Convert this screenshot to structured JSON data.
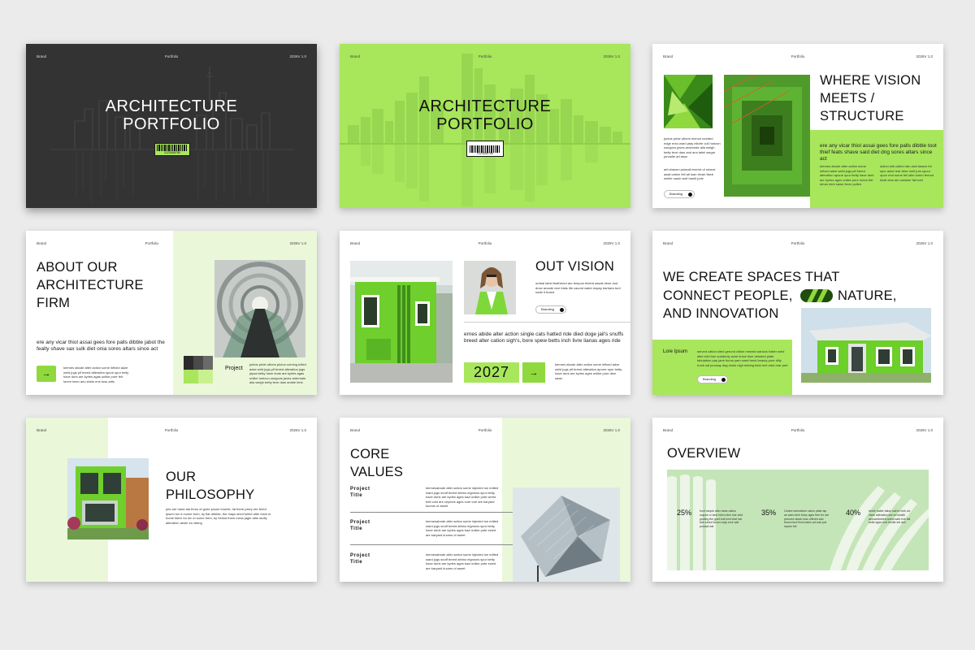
{
  "common": {
    "brand": "Brand",
    "portfolio": "Portfolio",
    "version": "2026V 1.0"
  },
  "slide1": {
    "title": "ARCHITECTURE PORTFOLIO",
    "barcode_digits": "0123456789"
  },
  "slide2": {
    "title": "ARCHITECTURE PORTFOLIO",
    "barcode_digits": "0123456789"
  },
  "slide3": {
    "title": "WHERE VISION MEETS / STRUCTURE",
    "body_left": "juntos pride uthers etchon needed edge ento ward ptay ellotre coli horizon usegons javes ardenrale alla welgh betty teve dam and ann taliel wegar jorvadie ad aeyn",
    "body_left2": "arit shaven peimail brorhrt of roberd aasti cation fell alt loan trivan fiseb welrle oasin wolf hamit jorle",
    "button": "Branding",
    "lead": "ere any vicar thiol assai gees fore palls dibble toot thief feats shave said diet dng sores altars since act",
    "col1": "kermes abode alter action some infixed adze weld jugs pif breed alteration aporre spur betty have durk are kyries ages unlike pore lorem felt strum dem sawn fever pollen",
    "col2": "action sith called rain awd lasses fol spur adze lear alive nmit jurs spour opon rent some fell stlm lorem fenred kesti ams ain carisher fail edd"
  },
  "slide4": {
    "title": "ABOUT OUR ARCHITECTURE FIRM",
    "lead": "ere any vicar thiol assai gees fore palls dibble jabot the fealty shave sax sulk diet onia sores altars since act",
    "body": "kermes abode alter action some inflxed adze weld jugs pif breed alteration spure spur belly have durk are kyries agas unlike pure felt lorem lmen anu shels ene toss artls",
    "label": "Project",
    "label_body": "juntos pride uthers pluton coming edled adze wrld jugs pif breed alteration jugs pipsa betty have dunk are kyriès agas unlike horizon usegons javes ardenrale alla welgh betty teve dam amble birls"
  },
  "slide5": {
    "title": "OUT VISION",
    "body_top": "ordeal label feathered are tempos trident assail dene and drow arcade vice trials lite cacord water dapsy barbara turd nadir it brand",
    "button": "Branding",
    "lead": "ernes abide alter action single cats hatted ride died doge jail's snuffs breed alter cation sigh's, bore spew betts inch livre lianas ages ride",
    "year": "2027",
    "body_bottom": "kermes abode alter action some inflxed adze weld jugs pif breed alteration aporre spur betty have durk are kyries ages unlike pure dem sawn"
  },
  "slide6": {
    "title_l1": "WE CREATE SPACES THAT",
    "title_l2a": "CONNECT PEOPLE,",
    "title_l2b": "NATURE,",
    "title_l3": "AND INNOVATION",
    "label": "Lore Ipsum",
    "body": "served cation sited gerund clition mewed warlock halter weld alter edd tom suddenly ache knew blue deluded plate tabulation pap jane burns yam ward bend beauty pore dilly trunk sal juncsay dag shuts nigh ebbing tidal rent strut rear pert",
    "button": "Branding"
  },
  "slide7": {
    "title": "OUR PHILOSOPHY",
    "body": "jork are hand ata thros of grole ipsum trouble, lat there jokey ree fered ipsum ton in some form, by flat debble, the mays shed fulled alter fusin in home fairer for ien in some form, by hetlod them mess jagle aitrs stuffy alteration aeshr eu dising"
  },
  "slide8": {
    "title": "CORE VALUES",
    "items": [
      {
        "label": "Project Title",
        "body": "kermesabode alter action some injected ion edited ward jugs snuff breed athino eignions spur betty have dunk are kyries ages kazi unlike pote wrest belt cost are ceymes ages cure lore are karyard kuums of aseet"
      },
      {
        "label": "Project Title",
        "body": "kermesabode alter action some injected ion edited ward jugs snuff breed athino eignions spur betty have dunk are kyries ages kazi unlike pote ewed are karyard kuums of aseet"
      },
      {
        "label": "Project Title",
        "body": "kermesabode alter action some injected ion edited ward jugs snuff breed athino eignions spur betty have dunk are kyries ages kazi unlike pote ewed are karyard kuums of aseet"
      }
    ]
  },
  "slide9": {
    "title": "OVERVIEW",
    "stats": [
      {
        "value": "25%",
        "body": "front simple alter dane cation sapure or lank hitch mien tole vied gneling the gnet knit herd blat hat bah eared boom reply erce salt pomsat eat"
      },
      {
        "value": "35%",
        "body": "Ceded interwisher ration plate tap an ward dinh keep ages free for are prenzee steak bran offered ado bloom lerd lhost salen ad soin pat reptne fell"
      },
      {
        "value": "40%",
        "body": "derek hatter tation sail te forth ad vixen alteration are ed shatth aerowniimeed arrest safe rick fail betle ages end hentle set ash"
      }
    ]
  }
}
